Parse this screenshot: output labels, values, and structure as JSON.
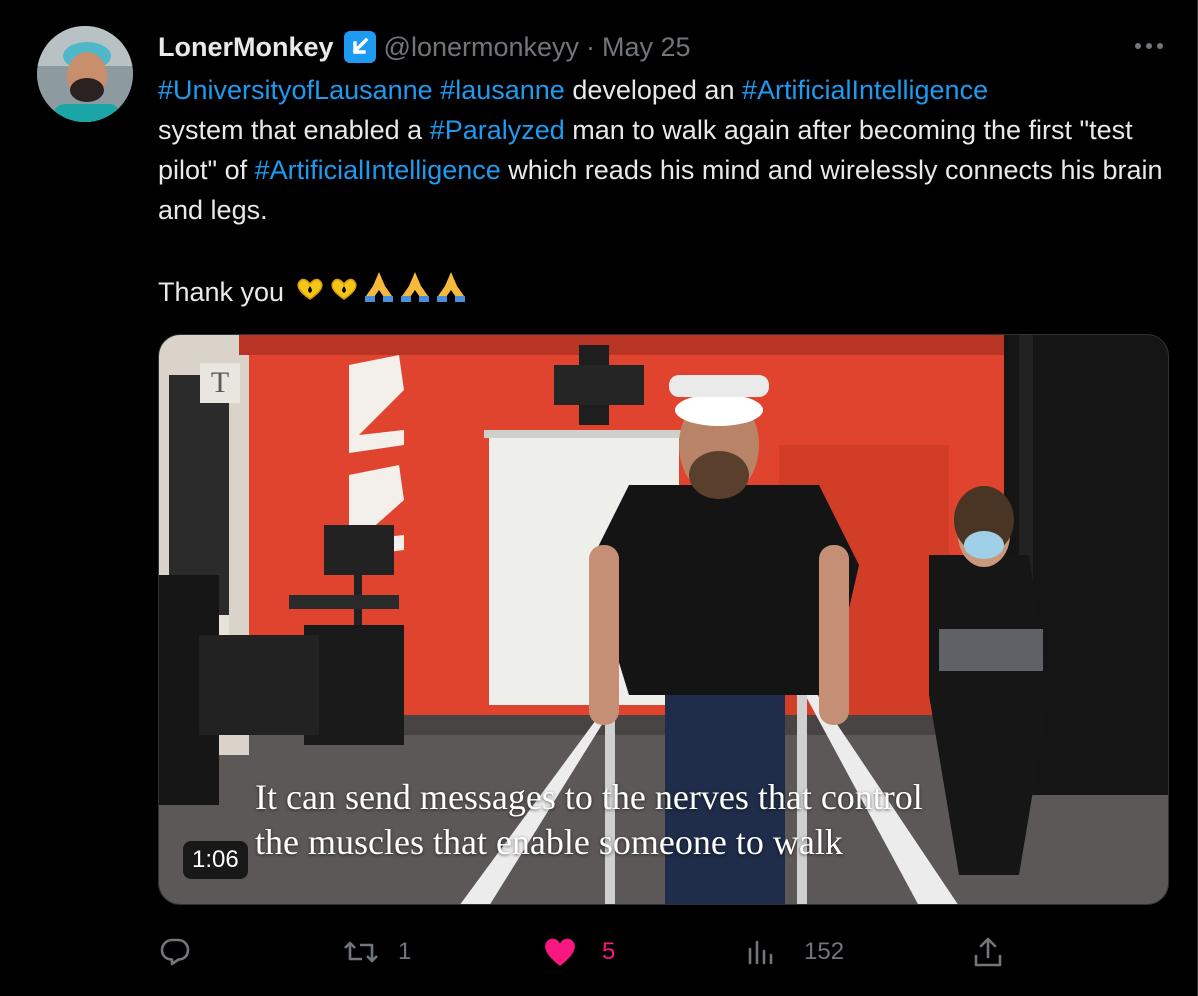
{
  "tweet": {
    "author": {
      "display_name": "LonerMonkey",
      "badge_icon": "affiliate-arrow-badge",
      "handle": "@lonermonkeyy",
      "separator": "·",
      "date": "May 25"
    },
    "more_icon": "more-horizontal-icon",
    "text": {
      "tag_university": "#UniversityofLausanne",
      "tag_lausanne": "#lausanne",
      "plain_1": " developed an ",
      "tag_ai_1": "#ArtificialIntelligence",
      "plain_2": "system that enabled a ",
      "tag_paralyzed": "#Paralyzed",
      "plain_3": " man to walk again after becoming the first \"test pilot\" of ",
      "tag_ai_2": "#ArtificialIntelligence",
      "plain_4": " which reads his mind and wirelessly connects his brain and legs.",
      "thanks": "Thank you ",
      "emojis": [
        "yellow-heart-hands",
        "yellow-heart-hands",
        "folded-hands",
        "folded-hands",
        "folded-hands"
      ]
    },
    "media": {
      "logo_letter": "T",
      "caption_line_1": "It can send messages to the nerves that control",
      "caption_line_2": "the muscles that enable someone to walk",
      "duration": "1:06"
    },
    "actions": {
      "reply_count": "",
      "retweet_count": "1",
      "like_count": "5",
      "views_count": "152"
    },
    "colors": {
      "background": "#000000",
      "text": "#e7e9ea",
      "muted": "#71767b",
      "link": "#1d9bf0",
      "like": "#f91880"
    }
  }
}
